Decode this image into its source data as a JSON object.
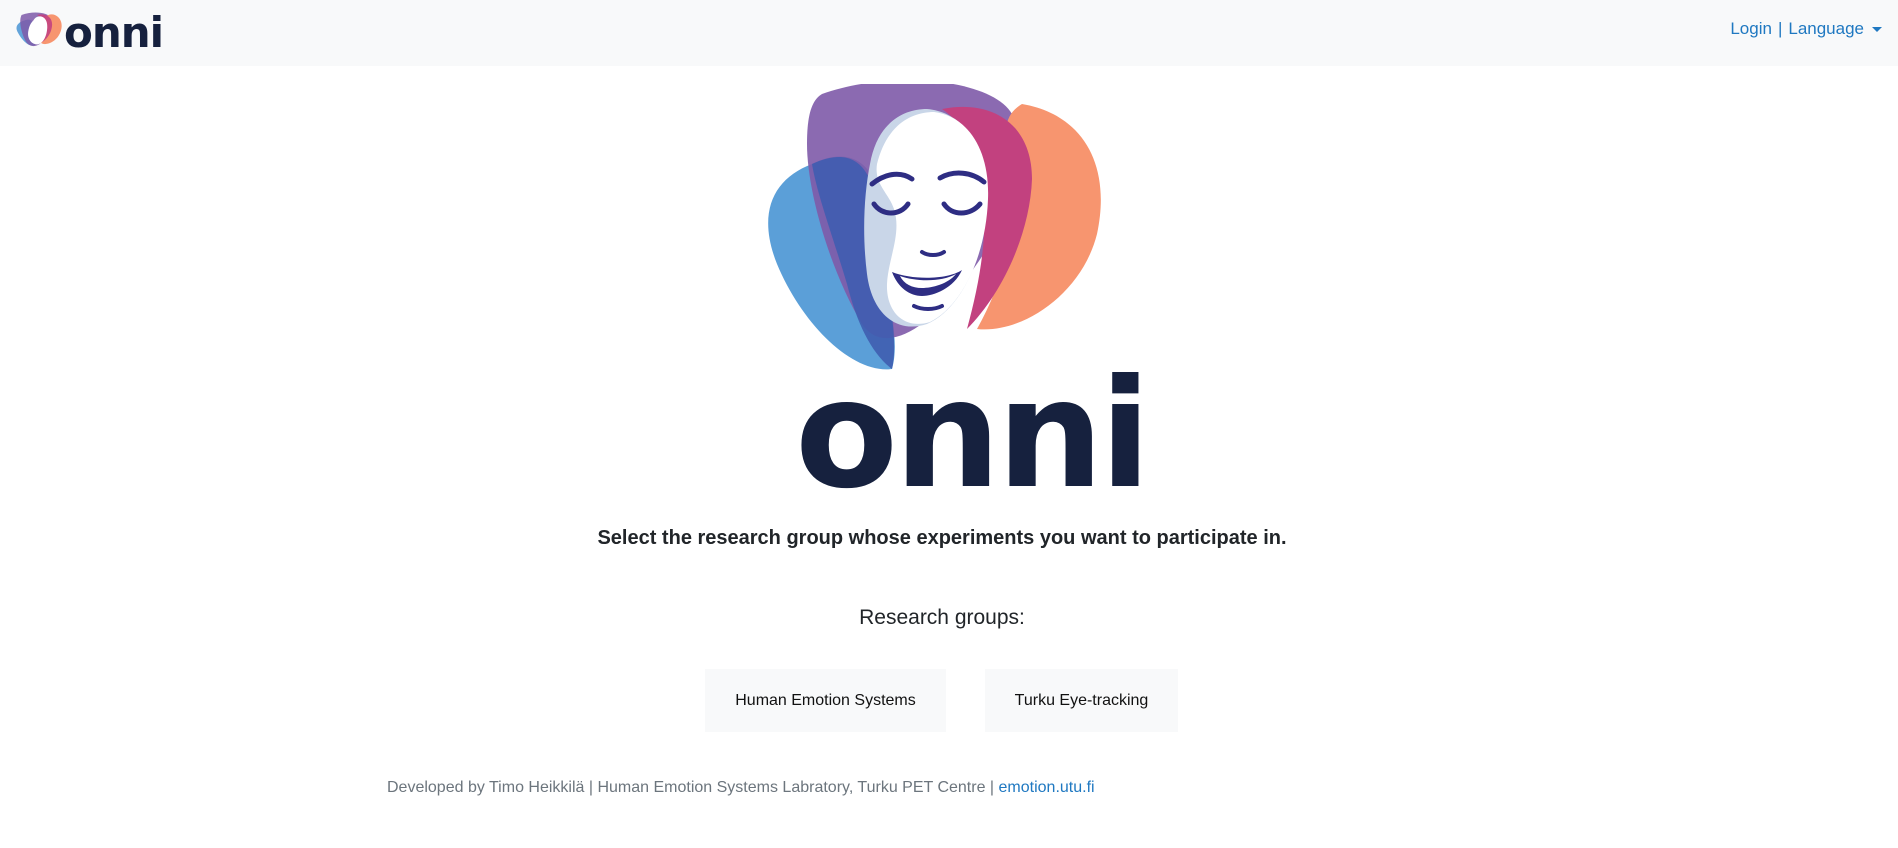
{
  "navbar": {
    "brand_text": "onni",
    "login_label": "Login",
    "separator": "|",
    "language_label": "Language",
    "link_color": "#1f78c1",
    "background": "#f8f9fa"
  },
  "hero": {
    "wordmark": "onni",
    "wordmark_color": "#16213e",
    "logo_colors": {
      "blue": "#5b9fd8",
      "purple": "#7e5aa8",
      "magenta": "#c2417f",
      "peach": "#f7956f",
      "face_features": "#2e2d83"
    }
  },
  "main": {
    "prompt": "Select the research group whose experiments you want to participate in.",
    "groups_heading": "Research groups:",
    "groups": [
      {
        "label": "Human Emotion Systems"
      },
      {
        "label": "Turku Eye-tracking"
      }
    ]
  },
  "footer": {
    "text": "Developed by Timo Heikkilä | Human Emotion Systems Labratory, Turku PET Centre |",
    "link_text": "emotion.utu.fi"
  }
}
